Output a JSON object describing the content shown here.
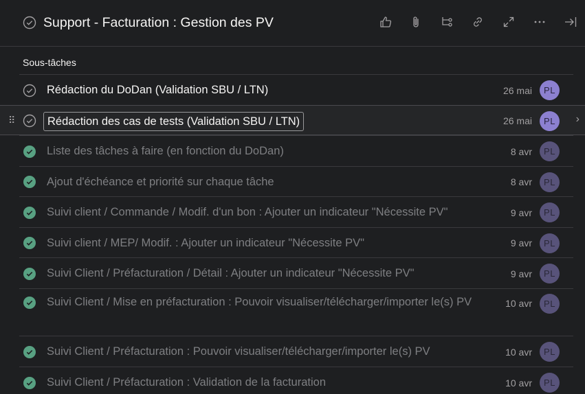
{
  "header": {
    "title": "Support - Facturation : Gestion des PV",
    "icons": [
      "like-icon",
      "attachment-icon",
      "subtask-icon",
      "link-icon",
      "expand-icon",
      "more-icon",
      "close-panel-icon"
    ]
  },
  "colors": {
    "background": "#1e1f21",
    "done_check": "#58a182",
    "avatar": "#8c80d0",
    "avatar_done": "#58537a"
  },
  "subtasks": {
    "section_label": "Sous-tâches",
    "items": [
      {
        "name": "Rédaction du DoDan (Validation SBU / LTN)",
        "date": "26 mai",
        "assignee": "PL",
        "done": false
      },
      {
        "name": "Rédaction des cas de tests (Validation SBU / LTN)",
        "date": "26 mai",
        "assignee": "PL",
        "done": false
      },
      {
        "name": "Liste des tâches à faire (en fonction du DoDan)",
        "date": "8 avr",
        "assignee": "PL",
        "done": true
      },
      {
        "name": "Ajout d'échéance et priorité sur chaque tâche",
        "date": "8 avr",
        "assignee": "PL",
        "done": true
      },
      {
        "name": "Suivi client / Commande / Modif. d'un bon : Ajouter un indicateur \"Nécessite PV\"",
        "date": "9 avr",
        "assignee": "PL",
        "done": true
      },
      {
        "name": "Suivi client / MEP/ Modif. : Ajouter un indicateur \"Nécessite PV\"",
        "date": "9 avr",
        "assignee": "PL",
        "done": true
      },
      {
        "name": "Suivi Client / Préfacturation / Détail : Ajouter un indicateur \"Nécessite PV\"",
        "date": "9 avr",
        "assignee": "PL",
        "done": true
      },
      {
        "name": "Suivi Client / Mise en préfacturation : Pouvoir visualiser/télécharger/importer le(s) PV",
        "date": "10 avr",
        "assignee": "PL",
        "done": true
      },
      {
        "name": "Suivi Client / Préfacturation : Pouvoir visualiser/télécharger/importer le(s) PV",
        "date": "10 avr",
        "assignee": "PL",
        "done": true
      },
      {
        "name": "Suivi Client / Préfacturation : Validation de la facturation",
        "date": "10 avr",
        "assignee": "PL",
        "done": true
      }
    ]
  }
}
